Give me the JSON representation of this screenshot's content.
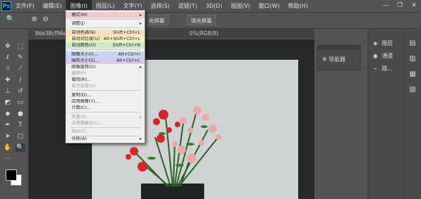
{
  "app": {
    "logo": "Ps"
  },
  "menubar": {
    "items": [
      {
        "label": "文件(F)"
      },
      {
        "label": "编辑(E)"
      },
      {
        "label": "图像(I)"
      },
      {
        "label": "图层(L)"
      },
      {
        "label": "文字(Y)"
      },
      {
        "label": "选择(S)"
      },
      {
        "label": "滤镜(T)"
      },
      {
        "label": "3D(D)"
      },
      {
        "label": "视图(V)"
      },
      {
        "label": "窗口(W)"
      },
      {
        "label": "帮助(H)"
      }
    ],
    "active_index": 2
  },
  "window_controls": {
    "minimize": "—",
    "restore": "❐",
    "close": "✕"
  },
  "options_bar": {
    "fill_screen_label": "填充屏幕",
    "fill_screen_partial": "充屏幕"
  },
  "document": {
    "tab_name": "86e38cf96e5",
    "tab_suffix": "0%(RGB/8)"
  },
  "image_menu": {
    "items": [
      {
        "label": "模式(M)",
        "shortcut": "",
        "submenu": true,
        "disabled": false,
        "highlight": "pink"
      },
      {
        "label": "调整(J)",
        "shortcut": "",
        "submenu": true,
        "disabled": false,
        "highlight": ""
      },
      {
        "label": "自动色调(N)",
        "shortcut": "Shift+Ctrl+L",
        "submenu": false,
        "disabled": false,
        "highlight": "orange"
      },
      {
        "label": "自动对比度(U)",
        "shortcut": "Alt+Shift+Ctrl+L",
        "submenu": false,
        "disabled": false,
        "highlight": "yellow"
      },
      {
        "label": "自动颜色(O)",
        "shortcut": "Shift+Ctrl+B",
        "submenu": false,
        "disabled": false,
        "highlight": "green"
      },
      {
        "label": "图像大小(I)...",
        "shortcut": "Alt+Ctrl+I",
        "submenu": false,
        "disabled": false,
        "highlight": "blue"
      },
      {
        "label": "画布大小(S)...",
        "shortcut": "Alt+Ctrl+C",
        "submenu": false,
        "disabled": false,
        "highlight": "purple"
      },
      {
        "label": "图像旋转(G)",
        "shortcut": "",
        "submenu": true,
        "disabled": false,
        "highlight": ""
      },
      {
        "label": "裁剪(P)",
        "shortcut": "",
        "submenu": false,
        "disabled": true,
        "highlight": ""
      },
      {
        "label": "裁切(R)...",
        "shortcut": "",
        "submenu": false,
        "disabled": false,
        "highlight": ""
      },
      {
        "label": "显示全部(V)",
        "shortcut": "",
        "submenu": false,
        "disabled": true,
        "highlight": ""
      },
      {
        "label": "复制(D)...",
        "shortcut": "",
        "submenu": false,
        "disabled": false,
        "highlight": ""
      },
      {
        "label": "应用图像(Y)...",
        "shortcut": "",
        "submenu": false,
        "disabled": false,
        "highlight": ""
      },
      {
        "label": "计算(C)...",
        "shortcut": "",
        "submenu": false,
        "disabled": false,
        "highlight": ""
      },
      {
        "label": "变量(B)",
        "shortcut": "",
        "submenu": true,
        "disabled": true,
        "highlight": ""
      },
      {
        "label": "应用数据组(L)...",
        "shortcut": "",
        "submenu": false,
        "disabled": true,
        "highlight": ""
      },
      {
        "label": "陷印(T)...",
        "shortcut": "",
        "submenu": false,
        "disabled": true,
        "highlight": ""
      },
      {
        "label": "分析(A)",
        "shortcut": "",
        "submenu": true,
        "disabled": false,
        "highlight": ""
      }
    ]
  },
  "navigator_panel": {
    "label": "导航器"
  },
  "panels": {
    "items": [
      {
        "label": "图层",
        "icon": "layers-icon"
      },
      {
        "label": "通道",
        "icon": "channels-icon"
      },
      {
        "label": "路...",
        "icon": "paths-icon"
      }
    ]
  },
  "colors": {
    "accent": "#31a8ff",
    "flower_red": "#d8242b",
    "flower_pink": "#e9a9a6",
    "stem_green": "#2f5e2a"
  }
}
